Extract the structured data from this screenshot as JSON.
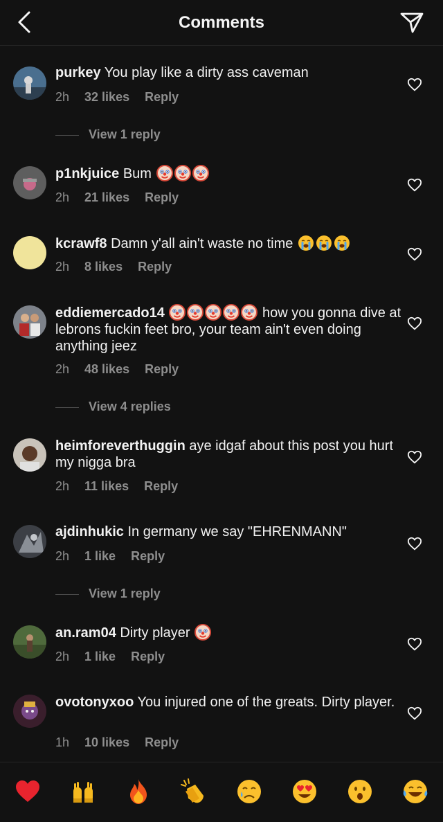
{
  "header": {
    "title": "Comments",
    "back_icon": "back-chevron-icon",
    "send_icon": "send-icon"
  },
  "comments": [
    {
      "username": "purkey",
      "text": "You play like a dirty ass caveman",
      "time": "2h",
      "likes": "32 likes",
      "reply": "Reply",
      "avatar_color": "#3a5878"
    },
    {
      "username": "p1nkjuice",
      "text": "Bum",
      "emojis": [
        "clown",
        "clown",
        "clown"
      ],
      "time": "2h",
      "likes": "21 likes",
      "reply": "Reply",
      "avatar_color": "#6a6a6a"
    },
    {
      "username": "kcrawf8",
      "text": "Damn y'all ain't waste no time",
      "emojis": [
        "sob",
        "sob",
        "sob"
      ],
      "time": "2h",
      "likes": "8 likes",
      "reply": "Reply",
      "avatar_color": "#f0e49b"
    },
    {
      "username": "eddiemercado14",
      "text": "how you gonna dive at lebrons fuckin feet bro, your team ain't even doing anything jeez",
      "emojis": [
        "clown",
        "clown",
        "clown",
        "clown",
        "clown"
      ],
      "time": "2h",
      "likes": "48 likes",
      "reply": "Reply",
      "avatar_color": "#8a8f98"
    },
    {
      "username": "heimforeverthuggin",
      "text": "aye idgaf about this post you hurt my nigga bra",
      "time": "2h",
      "likes": "11 likes",
      "reply": "Reply",
      "avatar_color": "#6b4a35"
    },
    {
      "username": "ajdinhukic",
      "text": "In germany we say \"EHRENMANN\"",
      "time": "2h",
      "likes": "1 like",
      "reply": "Reply",
      "avatar_color": "#4c5058"
    },
    {
      "username": "an.ram04",
      "text": "Dirty player",
      "emojis": [
        "clown"
      ],
      "time": "2h",
      "likes": "1 like",
      "reply": "Reply",
      "avatar_color": "#4f6a3c"
    },
    {
      "username": "ovotonyxoo",
      "text": "You injured one of the greats. Dirty player.",
      "time": "1h",
      "likes": "10 likes",
      "reply": "Reply",
      "avatar_color": "#5a2a3c"
    }
  ],
  "view_replies": [
    "View 1 reply",
    "View 4 replies",
    "View 1 reply"
  ],
  "quick_reactions": [
    "heart",
    "raising-hands",
    "fire",
    "clapping-hands",
    "crying-face",
    "heart-eyes",
    "astonished-face",
    "tears-of-joy"
  ],
  "colors": {
    "background": "#121212",
    "text": "#f5f5f5",
    "muted": "#8e8e8e",
    "divider": "#262626"
  }
}
